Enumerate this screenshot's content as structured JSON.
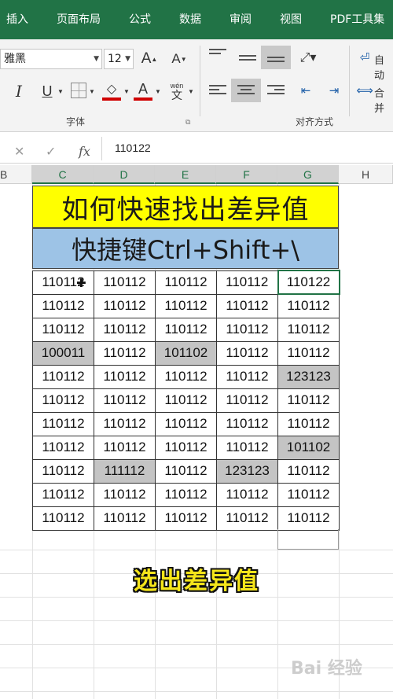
{
  "menu": {
    "tabs": [
      "插入",
      "页面布局",
      "公式",
      "数据",
      "审阅",
      "视图",
      "PDF工具集"
    ]
  },
  "ribbon": {
    "font_name": "雅黑",
    "font_size": "12",
    "font_group_label": "字体",
    "align_group_label": "对齐方式",
    "wrap_label": "自动",
    "merge_label": "合并",
    "wen_top": "wén",
    "wen_bottom": "文"
  },
  "formula_bar": {
    "fx": "fx",
    "value": "110122"
  },
  "columns": [
    "B",
    "C",
    "D",
    "E",
    "F",
    "G",
    "H"
  ],
  "sheet": {
    "title": "如何快速找出差异值",
    "subtitle": "快捷键Ctrl+Shift+\\",
    "rows": [
      [
        "110112",
        "110112",
        "110112",
        "110112",
        "110122"
      ],
      [
        "110112",
        "110112",
        "110112",
        "110112",
        "110112"
      ],
      [
        "110112",
        "110112",
        "110112",
        "110112",
        "110112"
      ],
      [
        "100011",
        "110112",
        "101102",
        "110112",
        "110112"
      ],
      [
        "110112",
        "110112",
        "110112",
        "110112",
        "123123"
      ],
      [
        "110112",
        "110112",
        "110112",
        "110112",
        "110112"
      ],
      [
        "110112",
        "110112",
        "110112",
        "110112",
        "110112"
      ],
      [
        "110112",
        "110112",
        "110112",
        "110112",
        "101102"
      ],
      [
        "110112",
        "111112",
        "110112",
        "123123",
        "110112"
      ],
      [
        "110112",
        "110112",
        "110112",
        "110112",
        "110112"
      ],
      [
        "110112",
        "110112",
        "110112",
        "110112",
        "110112"
      ]
    ],
    "highlighted": [
      [
        3,
        0
      ],
      [
        3,
        2
      ],
      [
        4,
        4
      ],
      [
        7,
        4
      ],
      [
        8,
        1
      ],
      [
        8,
        3
      ]
    ]
  },
  "caption": "选出差异值",
  "watermark": "Bai 经验",
  "colors": {
    "excel_green": "#217346",
    "title_yellow": "#ffff00",
    "subtitle_blue": "#9dc3e6",
    "diff_gray": "#c4c4c4",
    "caption_yellow": "#f5e51a"
  }
}
